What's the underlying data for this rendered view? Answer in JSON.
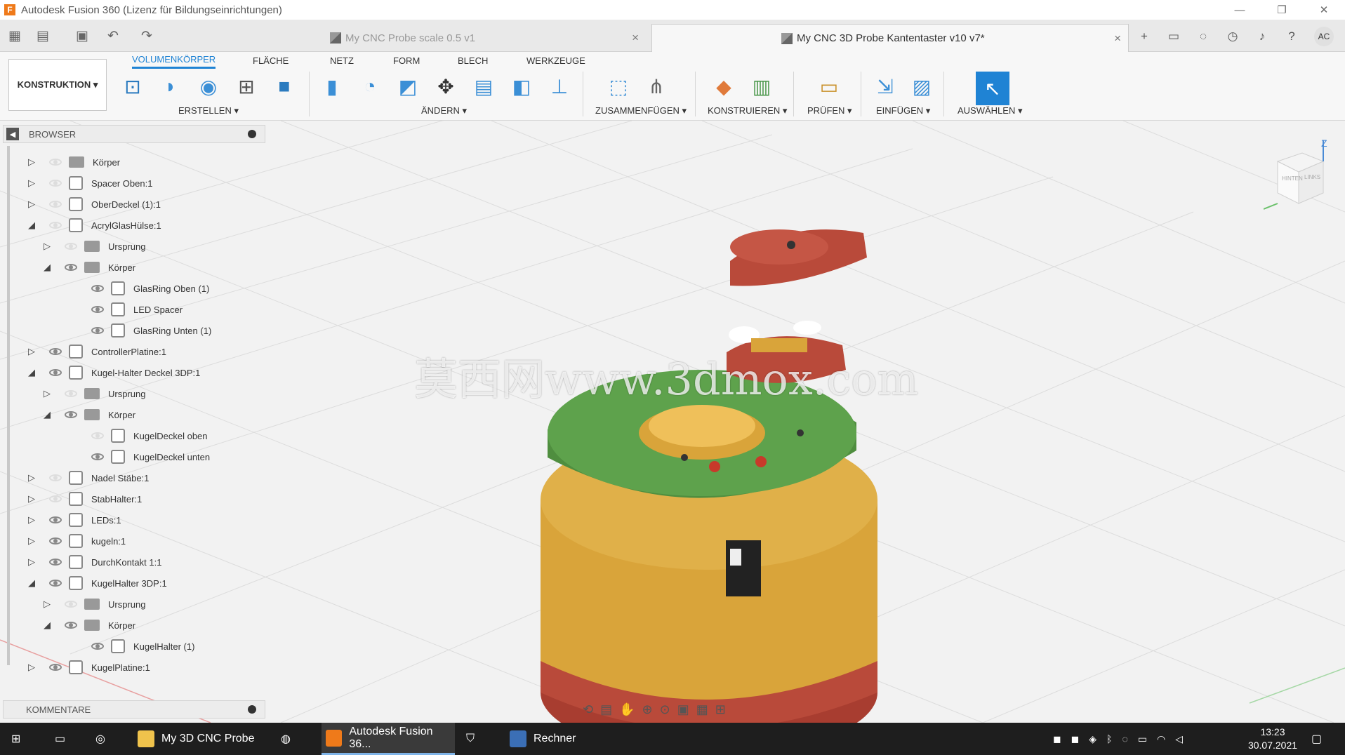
{
  "window": {
    "title": "Autodesk Fusion 360 (Lizenz für Bildungseinrichtungen)",
    "logo_letter": "F",
    "controls": [
      "—",
      "❐",
      "✕"
    ]
  },
  "tabs": {
    "inactive_tab": "My CNC Probe scale 0.5 v1",
    "active_tab": "My CNC 3D Probe Kantentaster v10 v7*",
    "close_glyph": "×",
    "user_initials": "AC"
  },
  "ribbon": {
    "workspace": "KONSTRUKTION ▾",
    "tabs": [
      "VOLUMENKÖRPER",
      "FLÄCHE",
      "NETZ",
      "FORM",
      "BLECH",
      "WERKZEUGE"
    ],
    "groups": {
      "erstellen": "ERSTELLEN ▾",
      "aendern": "ÄNDERN ▾",
      "zusammenfuegen": "ZUSAMMENFÜGEN ▾",
      "konstruieren": "KONSTRUIEREN ▾",
      "pruefen": "PRÜFEN ▾",
      "einfuegen": "EINFÜGEN ▾",
      "auswaehlen": "AUSWÄHLEN ▾"
    }
  },
  "browser": {
    "title": "BROWSER",
    "items": [
      {
        "name": "Körper",
        "expanded": false,
        "visible": false,
        "type": "folder",
        "level": 0
      },
      {
        "name": "Spacer Oben:1",
        "expanded": false,
        "visible": false,
        "type": "component",
        "level": 0
      },
      {
        "name": "OberDeckel (1):1",
        "expanded": false,
        "visible": false,
        "type": "component",
        "level": 0
      },
      {
        "name": "AcrylGlasHülse:1",
        "expanded": true,
        "visible": false,
        "type": "component",
        "level": 0
      },
      {
        "name": "Ursprung",
        "expanded": false,
        "visible": false,
        "type": "folder",
        "level": 1
      },
      {
        "name": "Körper",
        "expanded": true,
        "visible": true,
        "type": "folder",
        "level": 1
      },
      {
        "name": "GlasRing Oben (1)",
        "visible": true,
        "type": "body",
        "level": 2
      },
      {
        "name": "LED Spacer",
        "visible": true,
        "type": "body",
        "level": 2
      },
      {
        "name": "GlasRing Unten (1)",
        "visible": true,
        "type": "body",
        "level": 2
      },
      {
        "name": "ControllerPlatine:1",
        "expanded": false,
        "visible": true,
        "type": "component",
        "level": 0
      },
      {
        "name": "Kugel-Halter Deckel 3DP:1",
        "expanded": true,
        "visible": true,
        "type": "component",
        "level": 0
      },
      {
        "name": "Ursprung",
        "expanded": false,
        "visible": false,
        "type": "folder",
        "level": 1
      },
      {
        "name": "Körper",
        "expanded": true,
        "visible": true,
        "type": "folder",
        "level": 1
      },
      {
        "name": "KugelDeckel oben",
        "visible": false,
        "type": "body",
        "level": 2
      },
      {
        "name": "KugelDeckel unten",
        "visible": true,
        "type": "body",
        "level": 2
      },
      {
        "name": "Nadel Stäbe:1",
        "expanded": false,
        "visible": false,
        "type": "component",
        "level": 0
      },
      {
        "name": "StabHalter:1",
        "expanded": false,
        "visible": false,
        "type": "component",
        "level": 0
      },
      {
        "name": "LEDs:1",
        "expanded": false,
        "visible": true,
        "type": "component",
        "level": 0
      },
      {
        "name": "kugeln:1",
        "expanded": false,
        "visible": true,
        "type": "component",
        "level": 0
      },
      {
        "name": "DurchKontakt 1:1",
        "expanded": false,
        "visible": true,
        "type": "component",
        "level": 0
      },
      {
        "name": "KugelHalter 3DP:1",
        "expanded": true,
        "visible": true,
        "type": "component",
        "level": 0
      },
      {
        "name": "Ursprung",
        "expanded": false,
        "visible": false,
        "type": "folder",
        "level": 1
      },
      {
        "name": "Körper",
        "expanded": true,
        "visible": true,
        "type": "folder",
        "level": 1
      },
      {
        "name": "KugelHalter (1)",
        "visible": true,
        "type": "body",
        "level": 2
      },
      {
        "name": "KugelPlatine:1",
        "expanded": false,
        "visible": true,
        "type": "component",
        "level": 0
      }
    ]
  },
  "comments": {
    "title": "KOMMENTARE"
  },
  "watermark": "莫西网www.3dmox.com",
  "viewcube": {
    "top_label": "Z",
    "face_front": "HINTEN",
    "face_side": "LINKS"
  },
  "taskbar": {
    "items": [
      {
        "label": "My 3D CNC Probe"
      },
      {
        "label": "Autodesk Fusion 36..."
      },
      {
        "label": "Rechner"
      }
    ],
    "time": "13:23",
    "date": "30.07.2021"
  },
  "colors": {
    "accent": "#1f83d4",
    "part_red": "#b94a3a",
    "part_yellow": "#d9a43a",
    "part_green": "#4f8e3f"
  }
}
